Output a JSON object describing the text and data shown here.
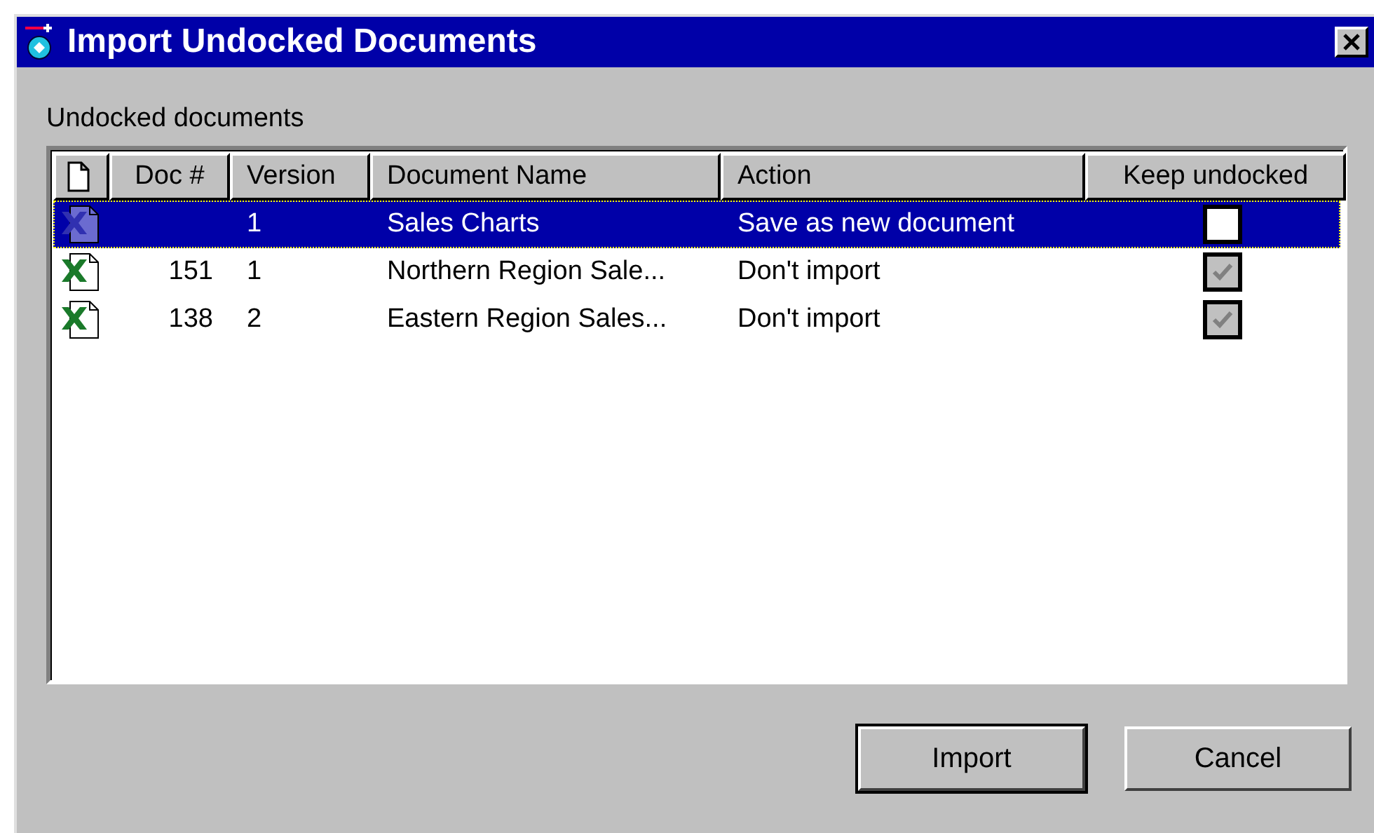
{
  "window": {
    "title": "Import Undocked Documents"
  },
  "list_label": "Undocked documents",
  "table": {
    "columns": [
      "Doc #",
      "Version",
      "Document Name",
      "Action",
      "Keep undocked"
    ],
    "rows": [
      {
        "version": "1",
        "name": "Sales Charts",
        "action": "Save as new document",
        "keep_undocked": {
          "checked": false,
          "disabled": false
        },
        "selected": true
      },
      {
        "doc": "151",
        "version": "1",
        "name": "Northern Region Sale...",
        "action": "Don't import",
        "keep_undocked": {
          "checked": true,
          "disabled": true
        },
        "selected": false
      },
      {
        "doc": "138",
        "version": "2",
        "name": "Eastern Region Sales...",
        "action": "Don't import",
        "keep_undocked": {
          "checked": true,
          "disabled": true
        },
        "selected": false
      }
    ]
  },
  "buttons": [
    {
      "label": "Import",
      "default": true
    },
    {
      "label": "Cancel",
      "default": false
    }
  ]
}
